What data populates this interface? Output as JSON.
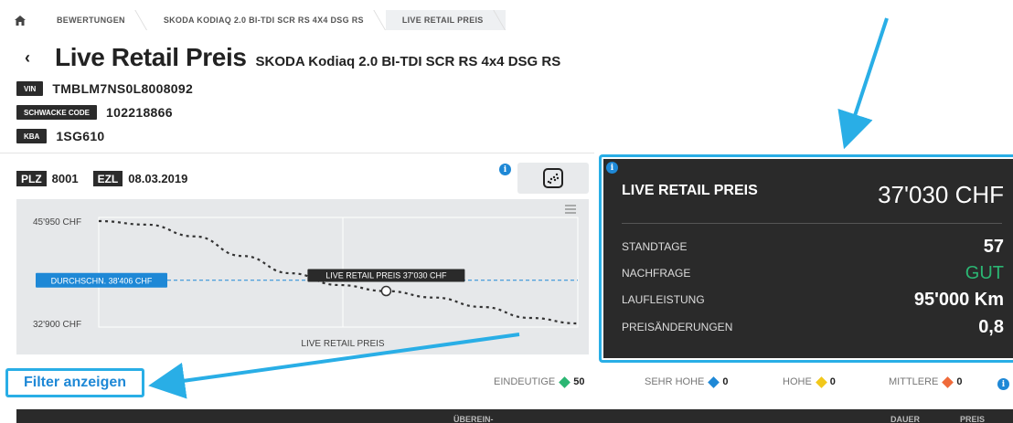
{
  "breadcrumb": {
    "items": [
      "BEWERTUNGEN",
      "SKODA KODIAQ 2.0 BI-TDI SCR RS 4X4 DSG RS",
      "LIVE RETAIL PREIS"
    ]
  },
  "header": {
    "back_glyph": "‹",
    "title": "Live Retail Preis",
    "subtitle": "SKODA Kodiaq 2.0 BI-TDI SCR RS 4x4 DSG RS"
  },
  "identifiers": [
    {
      "tag": "VIN",
      "value": "TMBLM7NS0L8008092"
    },
    {
      "tag": "SCHWACKE CODE",
      "value": "102218866"
    },
    {
      "tag": "KBA",
      "value": "1SG610"
    }
  ],
  "chart_meta": {
    "plz_tag": "PLZ",
    "plz_value": "8001",
    "ezl_tag": "EZL",
    "ezl_value": "08.03.2019"
  },
  "chart_data": {
    "type": "line",
    "ylabels": [
      "45'950 CHF",
      "32'900 CHF"
    ],
    "ylim": [
      32900,
      45950
    ],
    "average_label": "DURCHSCHN. 38'406 CHF",
    "average_value": 38406,
    "marker_label": "LIVE RETAIL PREIS 37'030 CHF",
    "marker_value": 37030,
    "xlabel": "LIVE RETAIL PREIS",
    "series": [
      {
        "x": [
          0,
          0.1,
          0.2,
          0.3,
          0.4,
          0.5,
          0.6,
          0.7,
          0.8,
          0.9,
          1.0
        ],
        "values": [
          45950,
          45500,
          44000,
          41500,
          39300,
          37800,
          37030,
          36200,
          35000,
          33600,
          32900
        ]
      }
    ],
    "grid": true,
    "line_style": "dashed"
  },
  "panel": {
    "title": "LIVE RETAIL PREIS",
    "price": "37'030 CHF",
    "rows": [
      {
        "label": "STANDTAGE",
        "value": "57",
        "color": "#ffffff"
      },
      {
        "label": "NACHFRAGE",
        "value": "GUT",
        "color": "#2bb673"
      },
      {
        "label": "LAUFLEISTUNG",
        "value": "95'000 Km",
        "color": "#ffffff"
      },
      {
        "label": "PREISÄNDERUNGEN",
        "value": "0,8",
        "color": "#ffffff"
      }
    ]
  },
  "filter": {
    "label": "Filter anzeigen"
  },
  "legend": [
    {
      "label": "EINDEUTIGE",
      "count": "50",
      "color": "#2bb673"
    },
    {
      "label": "SEHR HOHE",
      "count": "0",
      "color": "#1e88d6"
    },
    {
      "label": "HOHE",
      "count": "0",
      "color": "#f2c81b"
    },
    {
      "label": "MITTLERE",
      "count": "0",
      "color": "#ef6a3a"
    }
  ],
  "table_header": {
    "col1": "ÜBEREIN-",
    "col2": "DAUER",
    "col3": "PREIS"
  },
  "colors": {
    "accent": "#29aee6",
    "info": "#1e88d6",
    "dark": "#2a2a2a",
    "chart_bg": "#e6e8ea"
  }
}
